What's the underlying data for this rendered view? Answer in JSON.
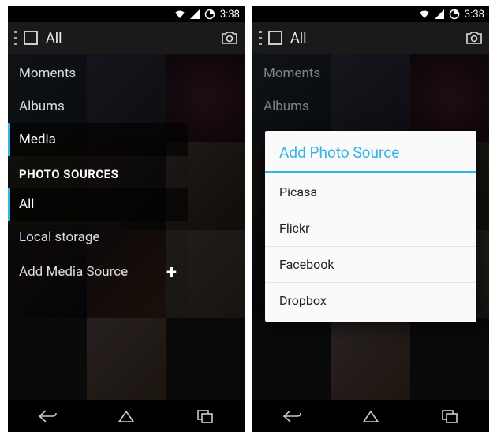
{
  "status": {
    "time": "3:38"
  },
  "header": {
    "title": "All"
  },
  "drawer": {
    "items": {
      "moments": "Moments",
      "albums": "Albums",
      "media": "Media"
    },
    "section": "PHOTO SOURCES",
    "sources": {
      "all": "All",
      "local": "Local storage",
      "add": "Add Media Source"
    }
  },
  "dialog": {
    "title": "Add Photo Source",
    "options": {
      "picasa": "Picasa",
      "flickr": "Flickr",
      "facebook": "Facebook",
      "dropbox": "Dropbox"
    }
  }
}
